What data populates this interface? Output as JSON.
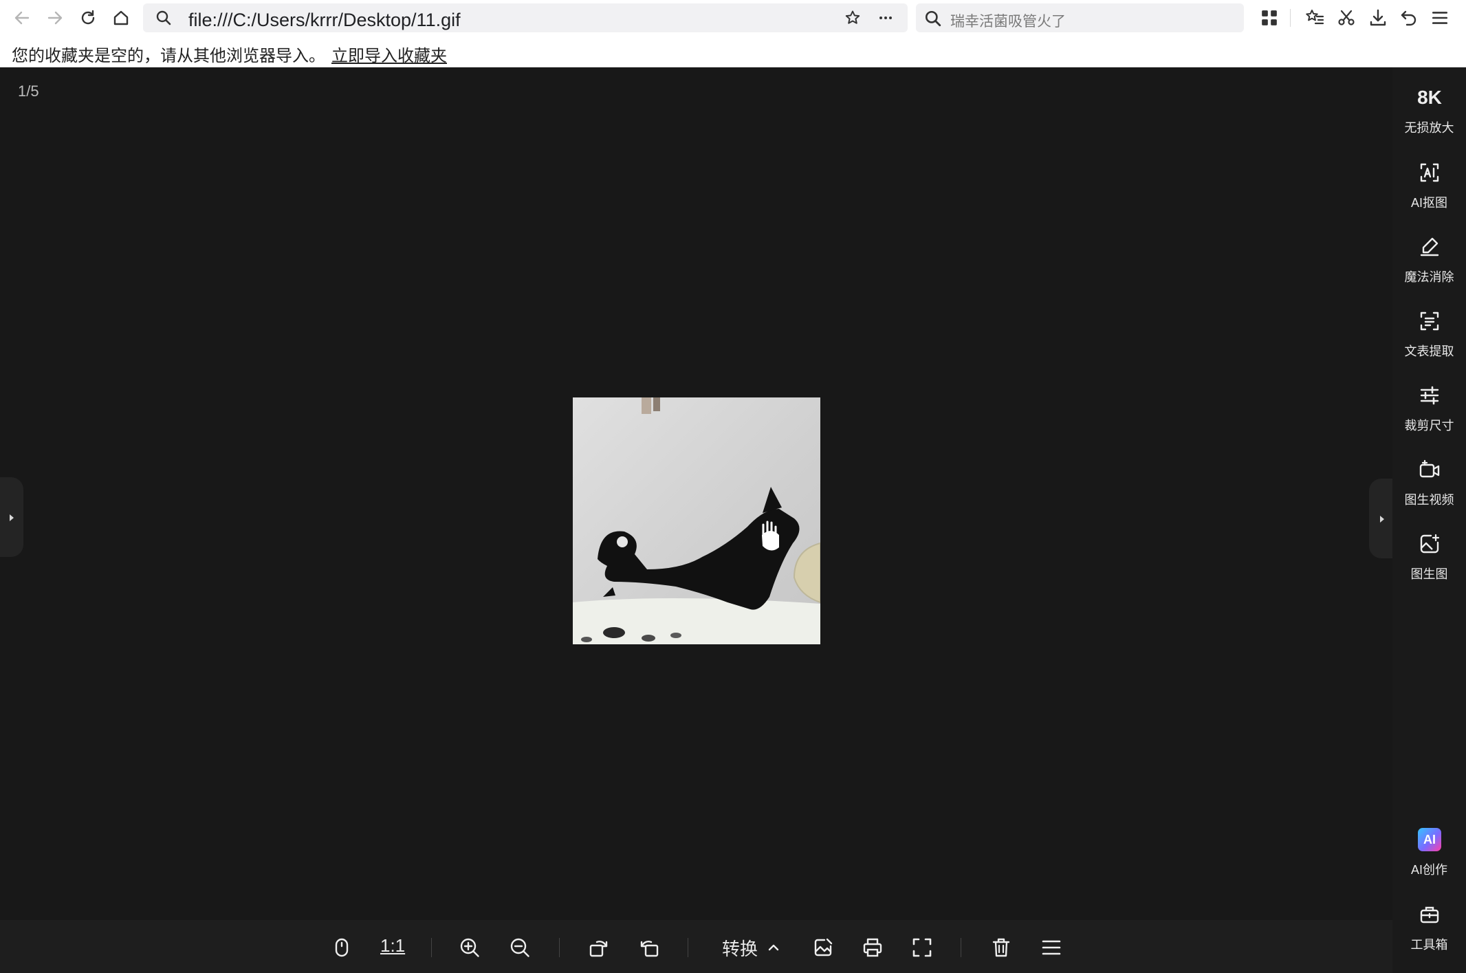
{
  "browser": {
    "address_url": "file:///C:/Users/krrr/Desktop/11.gif",
    "search_placeholder": "瑞幸活菌吸管火了"
  },
  "bookmarks_bar": {
    "message": "您的收藏夹是空的，请从其他浏览器导入。",
    "import_link": "立即导入收藏夹"
  },
  "viewer": {
    "page_indicator": "1/5",
    "right_panel": [
      {
        "label": "无损放大",
        "icon": "8k-upscale-icon",
        "glyph": "8K"
      },
      {
        "label": "AI抠图",
        "icon": "ai-cutout-icon"
      },
      {
        "label": "魔法消除",
        "icon": "magic-eraser-icon"
      },
      {
        "label": "文表提取",
        "icon": "text-extract-icon"
      },
      {
        "label": "裁剪尺寸",
        "icon": "crop-sliders-icon"
      },
      {
        "label": "图生视频",
        "icon": "image-to-video-icon"
      },
      {
        "label": "图生图",
        "icon": "image-to-image-icon"
      },
      {
        "label": "AI创作",
        "icon": "ai-create-icon",
        "badge": "AI"
      },
      {
        "label": "工具箱",
        "icon": "toolbox-icon"
      }
    ],
    "bottom_toolbar": {
      "actual_size_label": "1:1",
      "convert_label": "转换"
    }
  },
  "colors": {
    "viewer_bg": "#181818",
    "panel_bg": "#1a1a1a",
    "ai_badge_start": "#35c4ff",
    "ai_badge_end": "#ff3fa8"
  }
}
